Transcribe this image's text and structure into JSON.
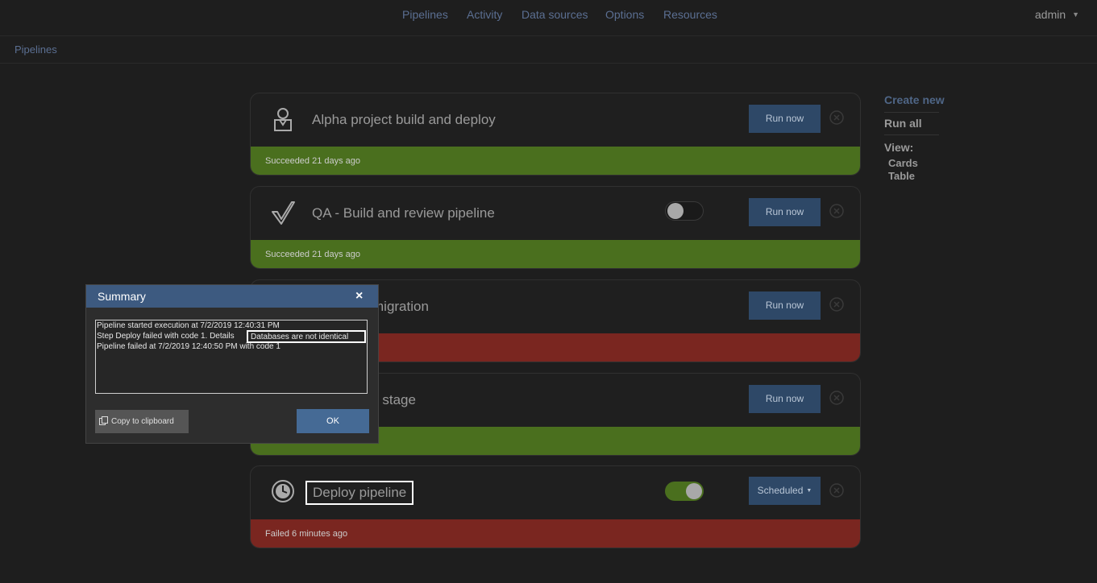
{
  "nav": {
    "links": [
      "Pipelines",
      "Activity",
      "Data sources",
      "Options",
      "Resources"
    ],
    "user": "admin"
  },
  "breadcrumb": "Pipelines",
  "pipelines": [
    {
      "title": "Alpha project build and deploy",
      "icon": "person-badge-icon",
      "status": "Succeeded 21 days ago",
      "action": "Run now"
    },
    {
      "title": "QA - Build and review pipeline",
      "icon": "checkmark-icon",
      "status": "Succeeded 21 days ago",
      "action": "Run now",
      "toggle": "off"
    },
    {
      "title": "migration",
      "status": "",
      "action": "Run now"
    },
    {
      "title": "- stage",
      "status": "",
      "action": "Run now"
    },
    {
      "title": "Deploy pipeline",
      "icon": "clock-icon",
      "status": "Failed 6 minutes ago",
      "action": "Scheduled",
      "toggle": "on"
    }
  ],
  "side": {
    "create_new": "Create new",
    "run_all": "Run all",
    "view_label": "View:",
    "view_options": [
      "Cards",
      "Table"
    ]
  },
  "dialog": {
    "title": "Summary",
    "close": "×",
    "log_lines": [
      "Pipeline started execution at 7/2/2019 12:40:31 PM",
      "Step Deploy failed with code 1. Details",
      "Pipeline failed at 7/2/2019 12:40:50 PM with code 1"
    ],
    "highlight": "Databases are not identical",
    "copy_label": "Copy to clipboard",
    "ok_label": "OK"
  },
  "colors": {
    "success": "#4a6f1e",
    "failed": "#7a2620",
    "button": "#2e4867",
    "dialog_header": "#3d5a80"
  }
}
